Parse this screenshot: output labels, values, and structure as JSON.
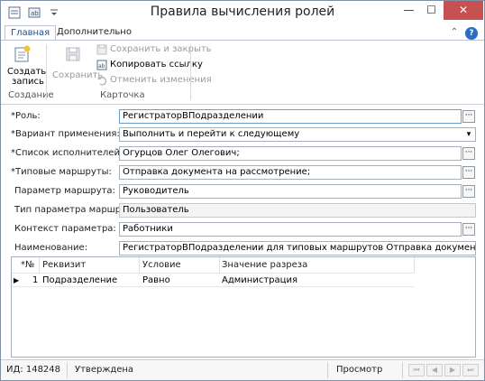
{
  "window": {
    "title": "Правила вычисления ролей",
    "minimize_glyph": "—",
    "maximize_glyph": "☐",
    "close_glyph": "✕"
  },
  "ribbon": {
    "tabs": [
      {
        "label": "Главная"
      },
      {
        "label": "Дополнительно"
      }
    ],
    "help_glyph": "?",
    "collapse_glyph": "⌃",
    "create": {
      "label_line1": "Создать",
      "label_line2": "запись",
      "group": "Создание"
    },
    "save": {
      "label": "Сохранить"
    },
    "save_close": {
      "label": "Сохранить и закрыть"
    },
    "copy_link": {
      "label": "Копировать ссылку"
    },
    "cancel_changes": {
      "label": "Отменить изменения"
    },
    "card_group": "Карточка"
  },
  "form": {
    "role": {
      "label": "*Роль:",
      "value": "РегистраторВПодразделении"
    },
    "variant": {
      "label": "*Вариант применения:",
      "value": "Выполнить  и перейти к следующему"
    },
    "performers": {
      "label": "*Список исполнителей:",
      "value": "Огурцов Олег Олегович;"
    },
    "routes": {
      "label": "*Типовые маршруты:",
      "value": "Отправка документа на рассмотрение;"
    },
    "route_param": {
      "label": "Параметр маршрута:",
      "value": "Руководитель"
    },
    "route_param_type": {
      "label": "Тип параметра маршрута:",
      "value": "Пользователь"
    },
    "param_context": {
      "label": "Контекст параметра:",
      "value": "Работники"
    },
    "name": {
      "label": "Наименование:",
      "value": "РегистраторВПодразделении для типовых маршрутов Отправка документа на рассмотрение"
    },
    "ellipsis_glyph": "···",
    "dropdown_glyph": "▾"
  },
  "grid": {
    "columns": [
      "*№",
      "Реквизит",
      "Условие",
      "Значение разреза"
    ],
    "rows": [
      {
        "marker": "▶",
        "num": "1",
        "attr": "Подразделение",
        "condition": "Равно",
        "value": "Администрация"
      }
    ]
  },
  "status": {
    "id": "ИД: 148248",
    "state": "Утверждена",
    "mode": "Просмотр",
    "nav": [
      "⏮",
      "◀",
      "▶",
      "⏭"
    ]
  },
  "colors": {
    "accent": "#1e4e8c",
    "close_bg": "#c75050"
  }
}
